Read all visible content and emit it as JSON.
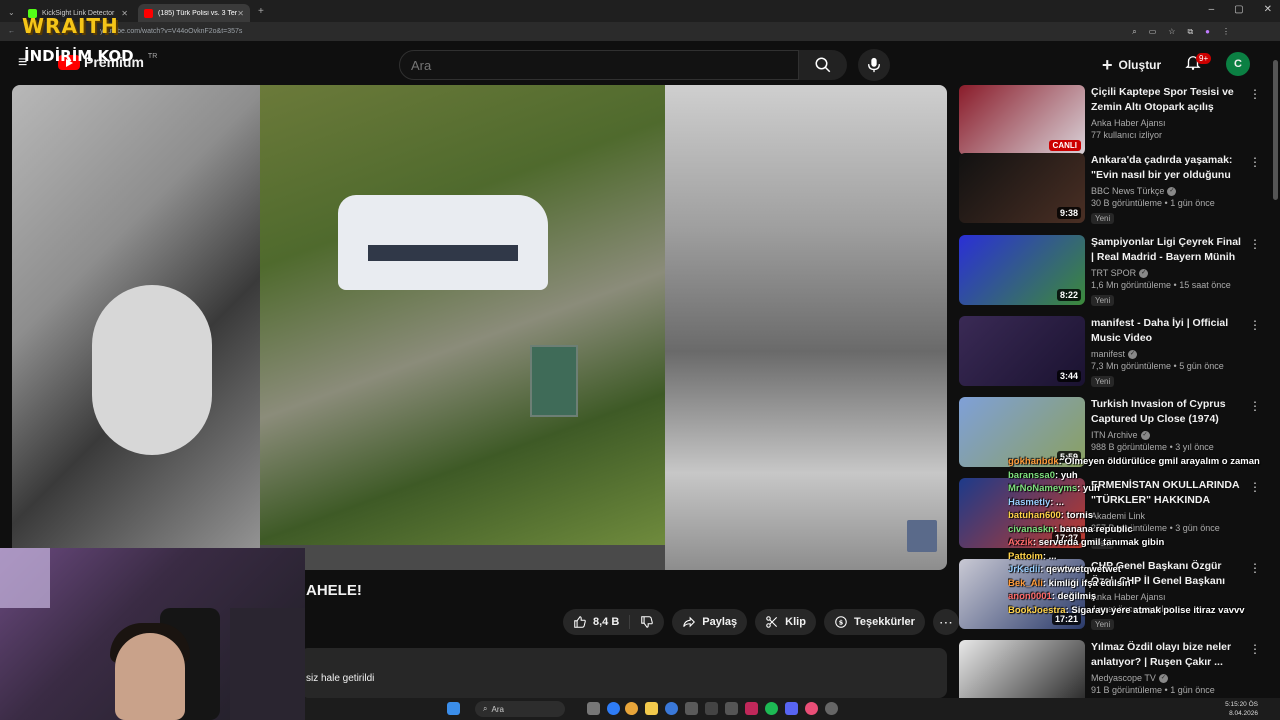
{
  "browser": {
    "tabs": [
      {
        "label": "KickSight Link Detector",
        "active": false,
        "favicon_color": "#53fc18"
      },
      {
        "label": "(185) Türk Polisi vs. 3 Terörist! Y",
        "active": true,
        "favicon_color": "#ff0000"
      }
    ],
    "url": "youtube.com/watch?v=V44oOvknF2o&t=357s"
  },
  "overlay": {
    "wraith_logo": "WRAITH",
    "promo_text": "İNDİRİM KOD"
  },
  "header": {
    "brand": "Premium",
    "region": "TR",
    "search_placeholder": "Ara",
    "create_label": "Oluştur",
    "notif_count": "9+",
    "avatar_letter": "C"
  },
  "video": {
    "title_fragment": "AHELE!",
    "like_count": "8,4 B",
    "share_label": "Paylaş",
    "clip_label": "Klip",
    "thanks_label": "Teşekkürler",
    "description_fragment": "siz hale getirildi"
  },
  "sidebar": {
    "items": [
      {
        "title": "Çiçili Kaptepe Spor Tesisi ve Zemin Altı Otopark açılış töre...",
        "channel": "Anka Haber Ajansı",
        "views": "77 kullanıcı izliyor",
        "age": "",
        "badge": "",
        "duration": "CANLI",
        "live": true,
        "verified": false,
        "thumb_colors": [
          "#8a1c2a",
          "#d9d2d8"
        ]
      },
      {
        "title": "Ankara'da çadırda yaşamak: \"Evin nasıl bir yer olduğunu ...",
        "channel": "BBC News Türkçe",
        "views": "30 B görüntüleme",
        "age": "1 gün önce",
        "badge": "Yeni",
        "duration": "9:38",
        "live": false,
        "verified": true,
        "thumb_colors": [
          "#111111",
          "#4a2f24"
        ]
      },
      {
        "title": "Şampiyonlar Ligi Çeyrek Final | Real Madrid - Bayern Münih ...",
        "channel": "TRT SPOR",
        "views": "1,6 Mn görüntüleme",
        "age": "15 saat önce",
        "badge": "Yeni",
        "duration": "8:22",
        "live": false,
        "verified": true,
        "thumb_colors": [
          "#2a2fd6",
          "#3c8a3a"
        ]
      },
      {
        "title": "manifest - Daha İyi | Official Music Video",
        "channel": "manifest",
        "views": "7,3 Mn görüntüleme",
        "age": "5 gün önce",
        "badge": "Yeni",
        "duration": "3:44",
        "live": false,
        "verified": true,
        "thumb_colors": [
          "#3a2a55",
          "#1a1230"
        ]
      },
      {
        "title": "Turkish Invasion of Cyprus Captured Up Close (1974)",
        "channel": "ITN Archive",
        "views": "988 B görüntüleme",
        "age": "3 yıl önce",
        "badge": "",
        "duration": "5:59",
        "live": false,
        "verified": true,
        "thumb_colors": [
          "#7fa0d8",
          "#8aa060"
        ]
      },
      {
        "title": "ERMENİSTAN OKULLARINDA \"TÜRKLER\" HAKKINDA NELER ...",
        "channel": "Akademi Link",
        "views": "257 B görüntüleme",
        "age": "3 gün önce",
        "badge": "Yeni",
        "duration": "17:27",
        "live": false,
        "verified": false,
        "thumb_colors": [
          "#1d3a8a",
          "#c0392b"
        ]
      },
      {
        "title": "CHP Genel Başkanı Özgür Özel, CHP İl Genel Başkanı Erkan Baş il...",
        "channel": "Anka Haber Ajansı",
        "views": "",
        "age": "4 saat önce yayınlan...",
        "badge": "Yeni",
        "duration": "17:21",
        "live": false,
        "verified": false,
        "thumb_colors": [
          "#c9c9d4",
          "#2a3a6a"
        ]
      },
      {
        "title": "Yılmaz Özdil olayı bize neler anlatıyor? | Ruşen Çakır ...",
        "channel": "Medyascope TV",
        "views": "91 B görüntüleme",
        "age": "1 gün önce",
        "badge": "",
        "duration": "",
        "live": false,
        "verified": true,
        "thumb_colors": [
          "#e8e8e8",
          "#222222"
        ]
      }
    ]
  },
  "chat": [
    {
      "user": "gokhanbdk",
      "msg": ": Ölmeyen öldürülüce gmil arayalım o zaman",
      "color": "#ff9b3a"
    },
    {
      "user": "baranssa0",
      "msg": ": yuh",
      "color": "#7fe07f"
    },
    {
      "user": "MrNoNameyms",
      "msg": ": yuh",
      "color": "#7fe07f"
    },
    {
      "user": "Hasmetly",
      "msg": ": ...",
      "color": "#9ad0ff"
    },
    {
      "user": "batuhan600",
      "msg": ": tornis",
      "color": "#ffd34a"
    },
    {
      "user": "civanaskn",
      "msg": ": banana republic",
      "color": "#7fe07f"
    },
    {
      "user": "Axzik",
      "msg": ": serverda gmil tanımak gibin",
      "color": "#ff6b6b"
    },
    {
      "user": "Pattoim",
      "msg": ": ...",
      "color": "#ffd34a"
    },
    {
      "user": "JrKedii",
      "msg": ": qewtwetqwetwet",
      "color": "#9ad0ff"
    },
    {
      "user": "Bek_Ali",
      "msg": ": kimliği ifşa edilsin",
      "color": "#ff9b3a"
    },
    {
      "user": "anon0001",
      "msg": ": değilmiş",
      "color": "#ff6b6b"
    },
    {
      "user": "BookJoestra",
      "msg": ": Sigarayı yere atmak polise itiraz vavvv",
      "color": "#ffd34a"
    }
  ],
  "taskbar": {
    "search_label": "Ara",
    "time": "5:15:20 ÖS",
    "date": "8.04.2026"
  }
}
